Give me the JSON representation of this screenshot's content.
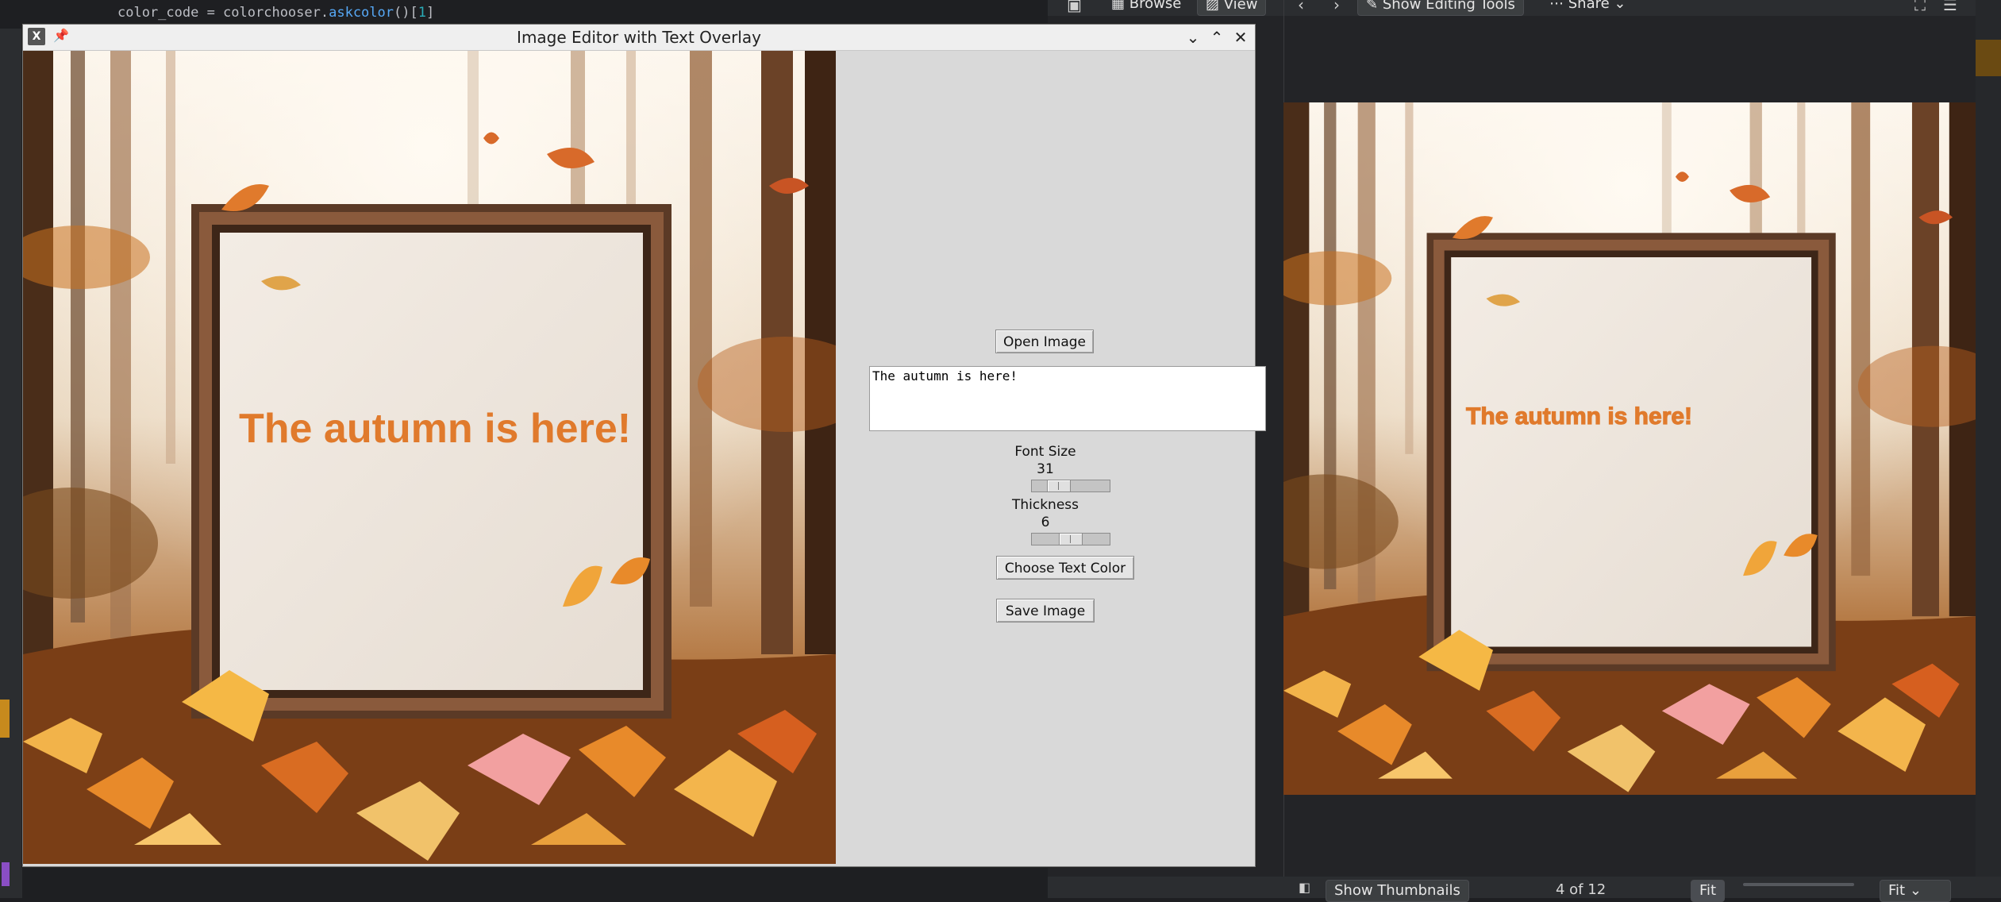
{
  "editor": {
    "gutter": "",
    "code_lhs": "color_code = colorchooser.",
    "code_fn": "askcolor",
    "code_paren": "()[",
    "code_num": "1",
    "code_close": "]"
  },
  "viewer": {
    "toolbar": {
      "browse_label": "Browse",
      "view_label": "View",
      "show_editing_tools_label": "Show Editing Tools",
      "share_label": "Share"
    },
    "overlay_text": "The autumn is here!",
    "bottom": {
      "show_thumbnails_label": "Show Thumbnails",
      "counter": "4 of 12",
      "fit_label": "Fit",
      "fit_select_value": "Fit"
    }
  },
  "window": {
    "title": "Image Editor with Text Overlay"
  },
  "controls": {
    "open_image_label": "Open Image",
    "text_value": "The autumn is here!",
    "font_size_label": "Font Size",
    "font_size_value": "31",
    "font_size_fraction": 0.28,
    "thickness_label": "Thickness",
    "thickness_value": "6",
    "thickness_fraction": 0.5,
    "choose_color_label": "Choose Text Color",
    "save_image_label": "Save Image"
  },
  "canvas": {
    "overlay_text": "The autumn is here!",
    "text_color": "#e07a2c"
  }
}
